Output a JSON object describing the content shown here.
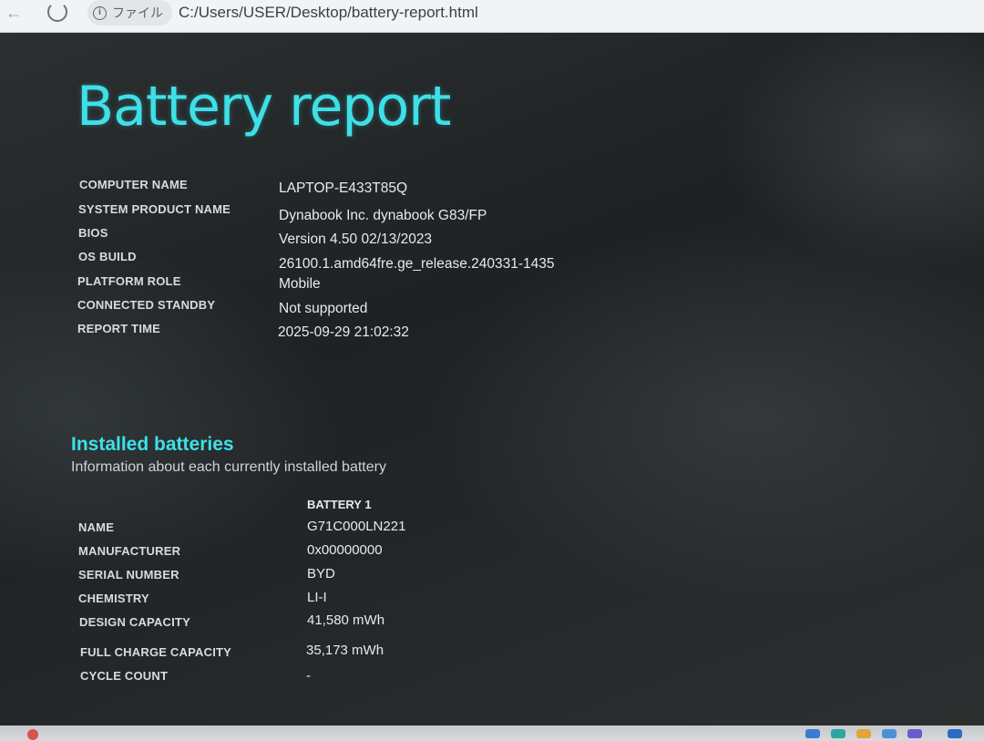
{
  "browser": {
    "site_label": "ファイル",
    "url": "C:/Users/USER/Desktop/battery-report.html"
  },
  "report": {
    "title": "Battery report",
    "system_info": [
      {
        "label": "COMPUTER NAME",
        "value": "LAPTOP-E433T85Q"
      },
      {
        "label": "SYSTEM PRODUCT NAME",
        "value": "Dynabook Inc. dynabook G83/FP"
      },
      {
        "label": "BIOS",
        "value": "Version 4.50 02/13/2023"
      },
      {
        "label": "OS BUILD",
        "value": "26100.1.amd64fre.ge_release.240331-1435"
      },
      {
        "label": "PLATFORM ROLE",
        "value": "Mobile"
      },
      {
        "label": "CONNECTED STANDBY",
        "value": "Not supported"
      },
      {
        "label": "REPORT TIME",
        "value": "2025-09-29  21:02:32"
      }
    ],
    "installed_batteries": {
      "title": "Installed batteries",
      "description": "Information about each currently installed battery",
      "column_header": "BATTERY 1",
      "rows": [
        {
          "label": "NAME",
          "value": "G71C000LN221"
        },
        {
          "label": "MANUFACTURER",
          "value": "0x00000000"
        },
        {
          "label": "SERIAL NUMBER",
          "value": "BYD"
        },
        {
          "label": "CHEMISTRY",
          "value": "LI-I"
        },
        {
          "label": "DESIGN CAPACITY",
          "value": "41,580 mWh"
        },
        {
          "label": "FULL CHARGE CAPACITY",
          "value": "35,173 mWh"
        },
        {
          "label": "CYCLE COUNT",
          "value": "-"
        }
      ]
    }
  },
  "colors": {
    "accent": "#3ee0e8",
    "background": "#202426",
    "text": "#e8ebeb"
  }
}
